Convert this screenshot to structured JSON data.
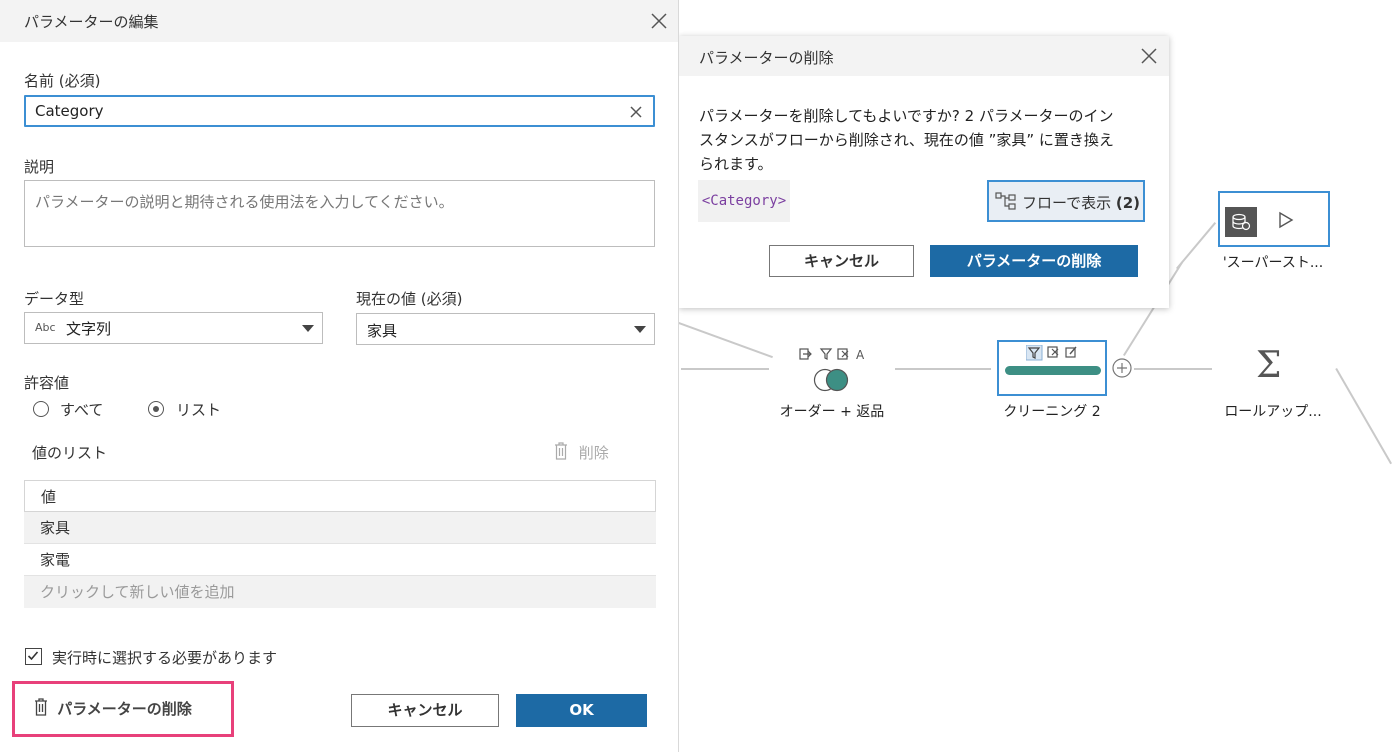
{
  "edit_panel": {
    "title": "パラメーターの編集",
    "name_label": "名前 (必須)",
    "name_value": "Category",
    "description_label": "説明",
    "description_placeholder": "パラメーターの説明と期待される使用法を入力してください。",
    "data_type_label": "データ型",
    "data_type_badge": "Abc",
    "data_type_value": "文字列",
    "current_value_label": "現在の値 (必須)",
    "current_value": "家具",
    "allowed_values_label": "許容値",
    "radio_all": "すべて",
    "radio_list": "リスト",
    "radio_selected": "list",
    "values_list_label": "値のリスト",
    "delete_value_label": "削除",
    "table_header": "値",
    "values": [
      "家具",
      "家電"
    ],
    "add_value_placeholder": "クリックして新しい値を追加",
    "required_checkbox_label": "実行時に選択する必要があります",
    "required_checked": true,
    "delete_parameter_label": "パラメーターの削除",
    "cancel_label": "キャンセル",
    "ok_label": "OK"
  },
  "dialog": {
    "title": "パラメーターの削除",
    "message_line1": "パラメーターを削除してもよいですか? 2 パラメーターのイン",
    "message_line2": "スタンスがフローから削除され、現在の値 ”家具” に置き換え",
    "message_line3": "られます。",
    "parameter_tag": "<Category>",
    "show_in_flow_label": "フローで表示",
    "show_in_flow_count": "(2)",
    "cancel_label": "キャンセル",
    "confirm_label": "パラメーターの削除"
  },
  "flow": {
    "join_label": "オーダー + 返品",
    "clean_label": "クリーニング 2",
    "rollup_label": "ロールアップ...",
    "output_label": "'スーパースト..."
  },
  "colors": {
    "accent": "#1d6aa5",
    "focus": "#3c8fd3",
    "highlight": "#e8407a",
    "clean_bar": "#3d8f84",
    "tag_text": "#7b3fa0"
  },
  "icons": {
    "close": "close-icon",
    "trash": "trash-icon",
    "dropdown": "chevron-down-icon",
    "flow": "flow-icon",
    "join": "join-icon",
    "filter": "filter-icon",
    "aggregate": "sigma-icon",
    "play": "play-icon",
    "database": "database-icon"
  }
}
